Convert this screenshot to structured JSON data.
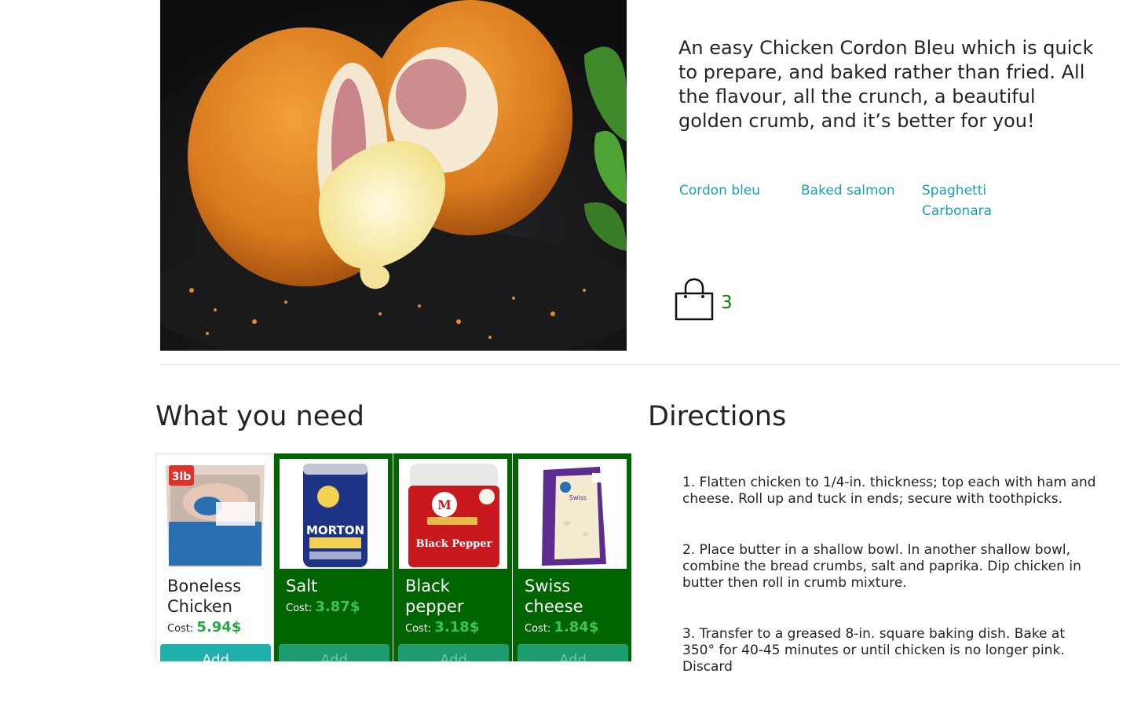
{
  "hero": {
    "image_alt": "Chicken Cordon Bleu",
    "description": "An easy Chicken Cordon Bleu which is quick to prepare, and baked rather than fried. All the flavour, all the crunch, a beautiful golden crumb, and it’s better for you!"
  },
  "related": [
    {
      "label": "Cordon bleu"
    },
    {
      "label": "Baked salmon"
    },
    {
      "label": "Spaghetti Carbonara"
    }
  ],
  "cart": {
    "icon": "shopping-bag-icon",
    "count": "3",
    "count_color": "#0a7d0a"
  },
  "sections": {
    "need_title": "What you need",
    "directions_title": "Directions"
  },
  "ingredients": [
    {
      "name": "Boneless Chicken",
      "cost_label": "Cost:",
      "price": "5.94$",
      "add_label": "Add",
      "selected": false,
      "package_text": "3lb"
    },
    {
      "name": "Salt",
      "cost_label": "Cost:",
      "price": "3.87$",
      "add_label": "Add",
      "selected": true,
      "package_text": "MORTON"
    },
    {
      "name": "Black pepper",
      "cost_label": "Cost:",
      "price": "3.18$",
      "add_label": "Add",
      "selected": true,
      "package_text": "Black Pepper"
    },
    {
      "name": "Swiss cheese",
      "cost_label": "Cost:",
      "price": "1.84$",
      "add_label": "Add",
      "selected": true,
      "package_text": "Swiss"
    }
  ],
  "directions": [
    "1. Flatten chicken to 1/4-in. thickness; top each with ham and cheese. Roll up and tuck in ends; secure with toothpicks.",
    "2. Place butter in a shallow bowl. In another shallow bowl, combine the bread crumbs, salt and paprika. Dip chicken in butter then roll in crumb mixture.",
    "3. Transfer to a greased 8-in. square baking dish. Bake at 350° for 40-45 minutes or until chicken is no longer pink. Discard"
  ],
  "colors": {
    "selected_card": "#006400",
    "link": "#17a2b8",
    "add_button": "#20b2aa",
    "price": "#28a745"
  }
}
